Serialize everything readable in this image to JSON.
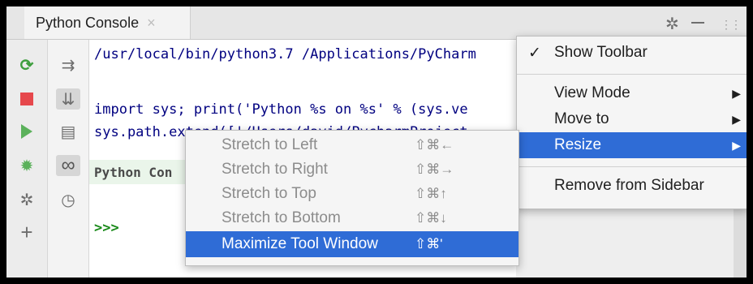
{
  "titlebar": {
    "tab_title": "Python Console",
    "tab_close": "×"
  },
  "editor": {
    "lines": [
      "/usr/local/bin/python3.7 /Applications/PyCharm",
      "import sys; print('Python %s on %s' % (sys.ve",
      "sys.path.extend(['/Users/david/PycharmProject"
    ],
    "console_header": "Python Con",
    "prompt": ">>>"
  },
  "context_menu": {
    "show_toolbar_check": "✓",
    "show_toolbar": "Show Toolbar",
    "view_mode": "View Mode",
    "move_to": "Move to",
    "resize": "Resize",
    "remove_from_sidebar": "Remove from Sidebar",
    "submenu_arrow": "▶"
  },
  "resize_submenu": {
    "items": [
      {
        "label": "Stretch to Left",
        "shortcut": "⇧⌘←"
      },
      {
        "label": "Stretch to Right",
        "shortcut": "⇧⌘→"
      },
      {
        "label": "Stretch to Top",
        "shortcut": "⇧⌘↑"
      },
      {
        "label": "Stretch to Bottom",
        "shortcut": "⇧⌘↓"
      },
      {
        "label": "Maximize Tool Window",
        "shortcut": "⇧⌘'"
      }
    ]
  },
  "icons": {
    "rerun": "⟳",
    "soft_wrap": "⇉",
    "scroll_end": "⇊",
    "print": "▤",
    "view_vars": "∞",
    "history": "◷",
    "debug": "✹",
    "settings": "✲",
    "add": "+",
    "gear": "✲",
    "grip": "⋮⋮"
  },
  "colors": {
    "selection": "#2f6cd6",
    "stop": "#e6484c",
    "run": "#5bb15b",
    "code": "#000080"
  }
}
